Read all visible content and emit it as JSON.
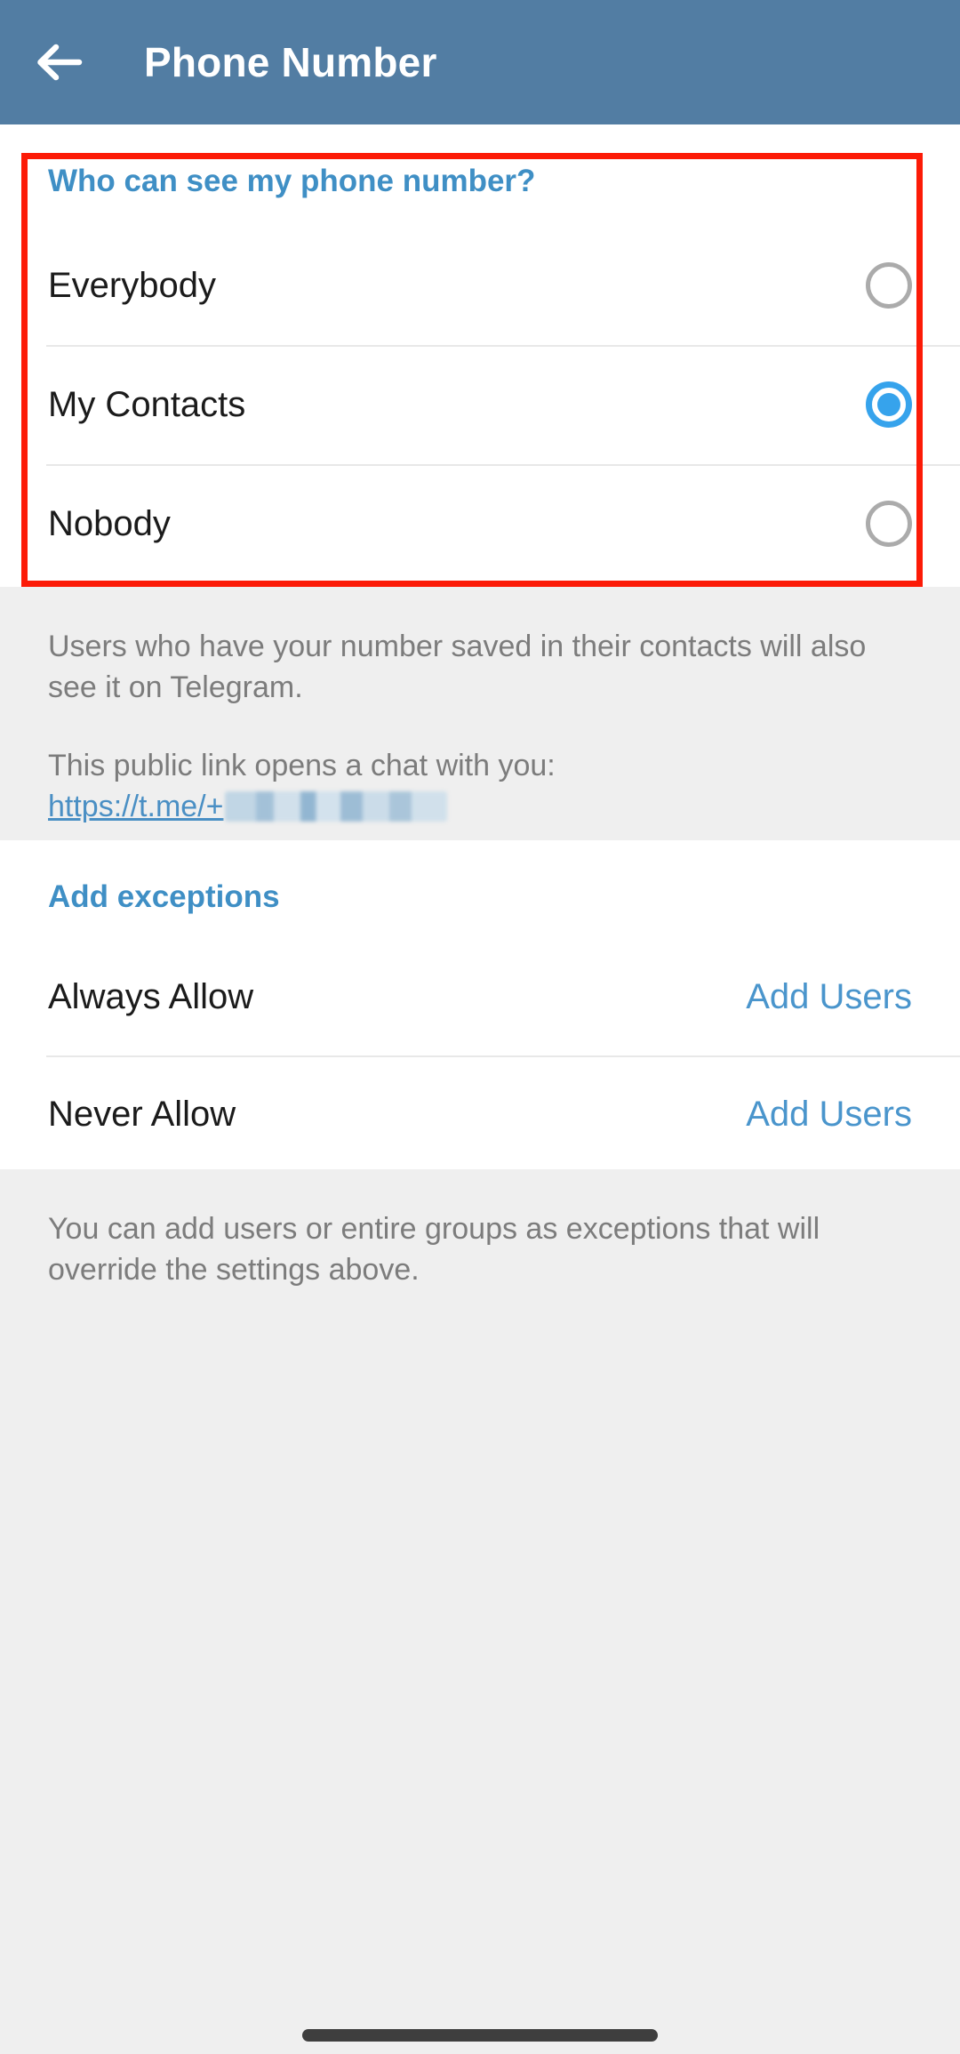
{
  "appbar": {
    "back_icon": "arrow-left-icon",
    "title": "Phone Number",
    "background": "#527da3"
  },
  "privacy_section": {
    "header": "Who can see my phone number?",
    "options": [
      {
        "label": "Everybody",
        "selected": false
      },
      {
        "label": "My Contacts",
        "selected": true
      },
      {
        "label": "Nobody",
        "selected": false
      }
    ],
    "selected_value": "My Contacts",
    "accent_color": "#36a3ec",
    "header_color": "#3f8fc5"
  },
  "privacy_footnote": {
    "description": "Users who have your number saved in their contacts will also see it on Telegram.",
    "link_intro": "This public link opens a chat with you:",
    "link_prefix": "https://t.me/+",
    "link_redacted": true
  },
  "exceptions_section": {
    "header": "Add exceptions",
    "rows": [
      {
        "label": "Always Allow",
        "action": "Add Users"
      },
      {
        "label": "Never Allow",
        "action": "Add Users"
      }
    ]
  },
  "exceptions_footnote": {
    "description": "You can add users or entire groups as exceptions that will override the settings above."
  },
  "annotation": {
    "color": "#fc1b07"
  }
}
